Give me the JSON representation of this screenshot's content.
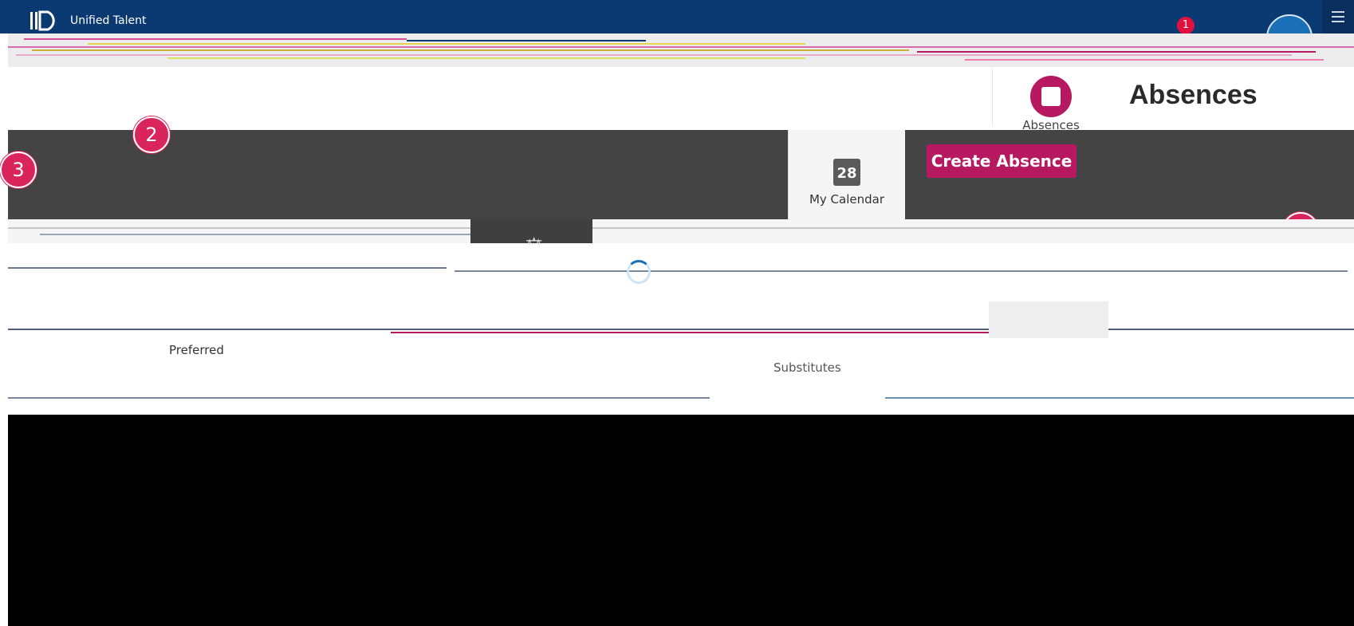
{
  "header": {
    "brand": "Unified Talent",
    "notification_count": "1",
    "logo_icon": "unified-talent-logo-icon",
    "menu_icon": "hamburger-icon"
  },
  "nav": {
    "absences_label": "Absences",
    "absences_icon": "calendar-star-icon"
  },
  "page": {
    "title": "Absences"
  },
  "actions": {
    "calendar_label": "My Calendar",
    "calendar_day": "28",
    "create_label": "Create Absence"
  },
  "callouts": [
    "1",
    "2",
    "3",
    "4"
  ],
  "lists": {
    "preferred_label": "Preferred",
    "substitutes_label": "Substitutes"
  },
  "colors": {
    "header_bg": "#0b3a72",
    "accent": "#b6195f",
    "dark_band": "#444444"
  }
}
